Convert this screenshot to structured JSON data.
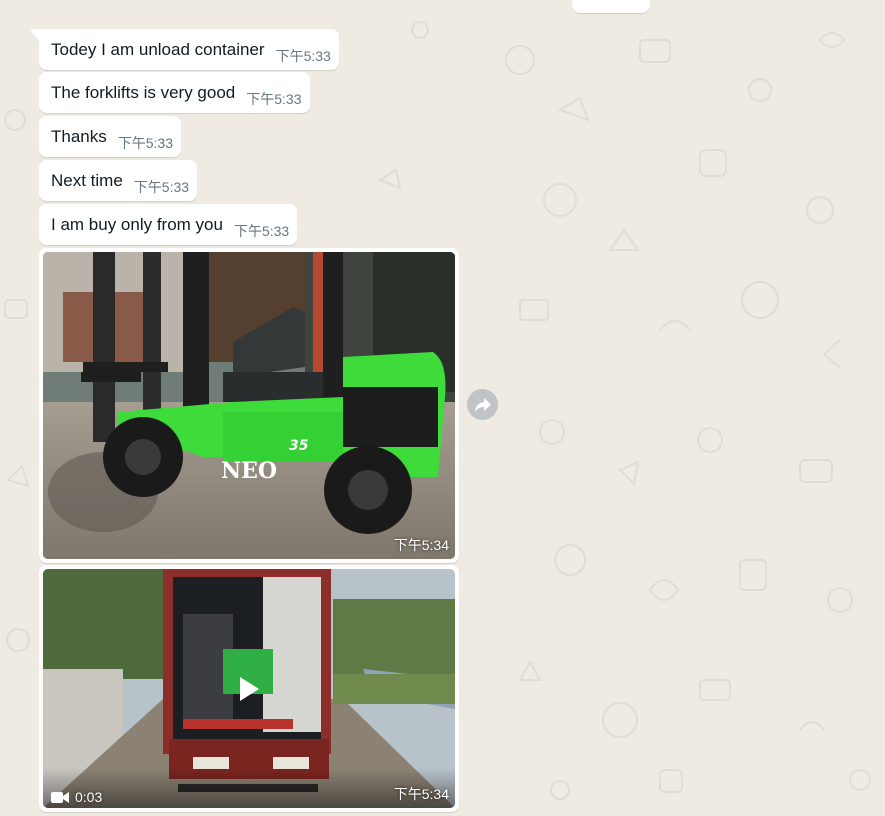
{
  "chat": {
    "messages": [
      {
        "text": "Todey I am unload container",
        "time": "下午5:33"
      },
      {
        "text": "The forklifts is very good",
        "time": "下午5:33"
      },
      {
        "text": "Thanks",
        "time": "下午5:33"
      },
      {
        "text": "Next time",
        "time": "下午5:33"
      },
      {
        "text": "I am buy only from you",
        "time": "下午5:33"
      }
    ],
    "image": {
      "time": "下午5:34",
      "brand_text": "NEO",
      "model_text": "35"
    },
    "video": {
      "time": "下午5:34",
      "duration": "0:03"
    }
  },
  "icons": {
    "forward": "forward-arrow-icon",
    "play": "play-icon",
    "video": "video-camera-icon"
  },
  "colors": {
    "chat_background": "#efeae2",
    "bubble_incoming": "#ffffff",
    "text_primary": "#111b21",
    "text_meta": "#667781",
    "forklift_green": "#3ddc3a"
  }
}
